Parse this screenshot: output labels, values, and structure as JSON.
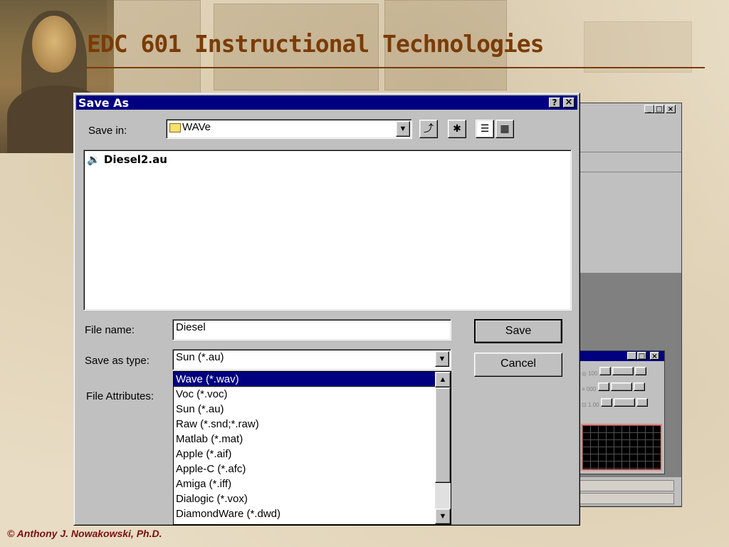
{
  "slide": {
    "title": "EDC 601  Instructional Technologies",
    "footer": "©  Anthony J. Nowakowski, Ph.D."
  },
  "dialog": {
    "title": "Save As",
    "help_btn": "?",
    "close_btn": "×",
    "save_in_label": "Save in:",
    "save_in_value": "WAVe",
    "files": [
      "Diesel2.au"
    ],
    "file_name_label": "File name:",
    "file_name_value": "Diesel",
    "save_type_label": "Save as type:",
    "save_type_value": "Sun (*.au)",
    "attributes_label": "File Attributes:",
    "save_button": "Save",
    "cancel_button": "Cancel",
    "type_options": [
      "Wave (*.wav)",
      "Voc (*.voc)",
      "Sun (*.au)",
      "Raw (*.snd;*.raw)",
      "Matlab (*.mat)",
      "Apple (*.aif)",
      "Apple-C (*.afc)",
      "Amiga (*.iff)",
      "Dialogic (*.vox)",
      "DiamondWare (*.dwd)"
    ],
    "selected_type_index": 0
  },
  "mixer": {
    "rows": [
      {
        "value": "100"
      },
      {
        "value": "000"
      },
      {
        "value": "1.00"
      }
    ]
  },
  "colors": {
    "title": "#7a3b05",
    "footer": "#7a1010",
    "titlebar": "#000080",
    "face": "#c0c0c0"
  }
}
